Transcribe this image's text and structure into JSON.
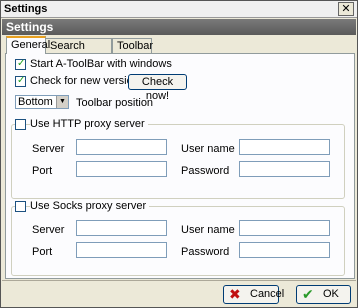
{
  "window": {
    "title": "Settings",
    "close_glyph": "✕"
  },
  "header": {
    "title": "Settings"
  },
  "tabs": [
    {
      "label": "General",
      "active": true
    },
    {
      "label": "Search engines",
      "active": false
    },
    {
      "label": "Toolbar",
      "active": false
    }
  ],
  "general": {
    "start_with_windows": {
      "label": "Start A-ToolBar with windows",
      "checked": true
    },
    "check_new_version": {
      "label": "Check for new version",
      "checked": true
    },
    "check_now_button": "Check now!",
    "toolbar_position": {
      "selected": "Bottom",
      "label": "Toolbar position"
    }
  },
  "http_proxy": {
    "label": "Use HTTP proxy server",
    "checked": false,
    "server_label": "Server",
    "username_label": "User name",
    "port_label": "Port",
    "password_label": "Password",
    "server_value": "",
    "username_value": "",
    "port_value": "",
    "password_value": ""
  },
  "socks_proxy": {
    "label": "Use Socks proxy server",
    "checked": false,
    "server_label": "Server",
    "username_label": "User name",
    "port_label": "Port",
    "password_label": "Password",
    "server_value": "",
    "username_value": "",
    "port_value": "",
    "password_value": ""
  },
  "footer": {
    "cancel_label": "Cancel",
    "ok_label": "OK",
    "cancel_icon": "cross-icon",
    "ok_icon": "checkmark-icon"
  },
  "colors": {
    "header_band": "#6a6a6a",
    "check_green": "#21a121",
    "cancel_red": "#c01010"
  }
}
